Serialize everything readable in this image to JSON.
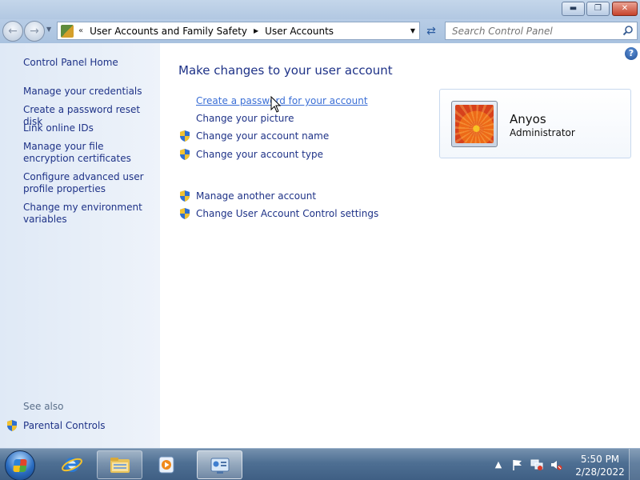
{
  "window": {
    "minimize_glyph": "▬",
    "maximize_glyph": "❐",
    "close_glyph": "✕"
  },
  "address_bar": {
    "breadcrumbs": [
      "User Accounts and Family Safety",
      "User Accounts"
    ],
    "overflow_chevron": "«",
    "crumb_separator": "▶",
    "dropdown_glyph": "▼"
  },
  "search": {
    "placeholder": "Search Control Panel"
  },
  "left_pane": {
    "home_link": "Control Panel Home",
    "links": [
      "Manage your credentials",
      "Create a password reset disk",
      "Link online IDs",
      "Manage your file encryption certificates",
      "Configure advanced user profile properties",
      "Change my environment variables"
    ],
    "see_also_label": "See also",
    "see_also_links": [
      "Parental Controls"
    ]
  },
  "main": {
    "heading": "Make changes to your user account",
    "tasks": [
      {
        "label": "Create a password for your account",
        "shield": false,
        "hovered": true
      },
      {
        "label": "Change your picture",
        "shield": false,
        "hovered": false
      },
      {
        "label": "Change your account name",
        "shield": true,
        "hovered": false
      },
      {
        "label": "Change your account type",
        "shield": true,
        "hovered": false
      }
    ],
    "other_tasks": [
      {
        "label": "Manage another account",
        "shield": true
      },
      {
        "label": "Change User Account Control settings",
        "shield": true
      }
    ],
    "help_glyph": "?"
  },
  "user_card": {
    "name": "Anyos",
    "role": "Administrator",
    "picture": "orange-flower-picture"
  },
  "taskbar": {
    "pinned": [
      "internet-explorer-icon",
      "windows-explorer-icon",
      "windows-media-player-icon",
      "control-panel-icon"
    ],
    "tray_icons": [
      "show-hidden-icons-icon",
      "action-center-flag-icon",
      "network-icon",
      "volume-muted-icon"
    ],
    "tray_overflow_glyph": "▲",
    "time": "5:50 PM",
    "date": "2/28/2022"
  },
  "colors": {
    "link": "#1e3287",
    "link_hover": "#3b6fd6",
    "left_pane_bg": "#dfe9f6",
    "taskbar_bg": "#4e6f93"
  }
}
